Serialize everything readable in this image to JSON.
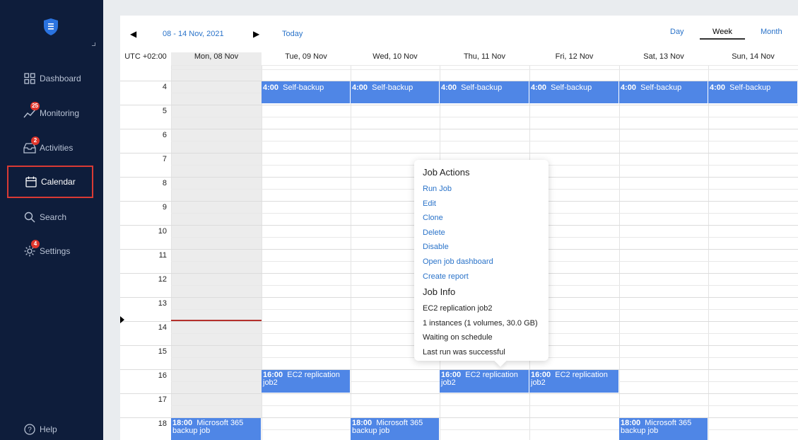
{
  "sidebar": {
    "items": [
      {
        "key": "dashboard",
        "label": "Dashboard",
        "icon": "grid-icon",
        "badge": ""
      },
      {
        "key": "monitoring",
        "label": "Monitoring",
        "icon": "chart-line-icon",
        "badge": "25"
      },
      {
        "key": "activities",
        "label": "Activities",
        "icon": "inbox-icon",
        "badge": "2"
      },
      {
        "key": "calendar",
        "label": "Calendar",
        "icon": "calendar-icon",
        "badge": "",
        "active": true
      },
      {
        "key": "search",
        "label": "Search",
        "icon": "search-icon",
        "badge": ""
      },
      {
        "key": "settings",
        "label": "Settings",
        "icon": "gear-icon",
        "badge": "4"
      }
    ],
    "help_label": "Help"
  },
  "toolbar": {
    "range": "08 - 14 Nov, 2021",
    "today": "Today",
    "views": [
      "Day",
      "Week",
      "Month"
    ],
    "active_view": "Week"
  },
  "calendar": {
    "timezone": "UTC +02:00",
    "days": [
      "Mon, 08 Nov",
      "Tue, 09 Nov",
      "Wed, 10 Nov",
      "Thu, 11 Nov",
      "Fri, 12 Nov",
      "Sat, 13 Nov",
      "Sun, 14 Nov"
    ],
    "hours": [
      "4",
      "5",
      "6",
      "7",
      "8",
      "9",
      "10",
      "11",
      "12",
      "13",
      "14",
      "15",
      "16",
      "17",
      "18"
    ],
    "events": [
      {
        "day": 1,
        "hour": 4,
        "time": "4:00",
        "title": "Self-backup"
      },
      {
        "day": 2,
        "hour": 4,
        "time": "4:00",
        "title": "Self-backup"
      },
      {
        "day": 3,
        "hour": 4,
        "time": "4:00",
        "title": "Self-backup"
      },
      {
        "day": 4,
        "hour": 4,
        "time": "4:00",
        "title": "Self-backup"
      },
      {
        "day": 5,
        "hour": 4,
        "time": "4:00",
        "title": "Self-backup"
      },
      {
        "day": 6,
        "hour": 4,
        "time": "4:00",
        "title": "Self-backup"
      },
      {
        "day": 1,
        "hour": 16,
        "time": "16:00",
        "title": "EC2 replication job2"
      },
      {
        "day": 3,
        "hour": 16,
        "time": "16:00",
        "title": "EC2 replication job2"
      },
      {
        "day": 4,
        "hour": 16,
        "time": "16:00",
        "title": "EC2 replication job2"
      },
      {
        "day": 0,
        "hour": 18,
        "time": "18:00",
        "title": "Microsoft 365 backup job"
      },
      {
        "day": 2,
        "hour": 18,
        "time": "18:00",
        "title": "Microsoft 365 backup job"
      },
      {
        "day": 5,
        "hour": 18,
        "time": "18:00",
        "title": "Microsoft 365 backup job"
      }
    ]
  },
  "popup": {
    "actions_title": "Job Actions",
    "actions": [
      "Run Job",
      "Edit",
      "Clone",
      "Delete",
      "Disable",
      "Open job dashboard",
      "Create report"
    ],
    "info_title": "Job Info",
    "info": [
      "EC2 replication job2",
      "1 instances (1 volumes, 30.0 GB)",
      "Waiting on schedule",
      "Last run was successful"
    ]
  },
  "colors": {
    "sidebar_bg": "#0e1d3b",
    "event_bg": "#4f86e6",
    "link": "#2a73c9",
    "badge": "#e0352b",
    "active_outline": "#d93a34"
  }
}
